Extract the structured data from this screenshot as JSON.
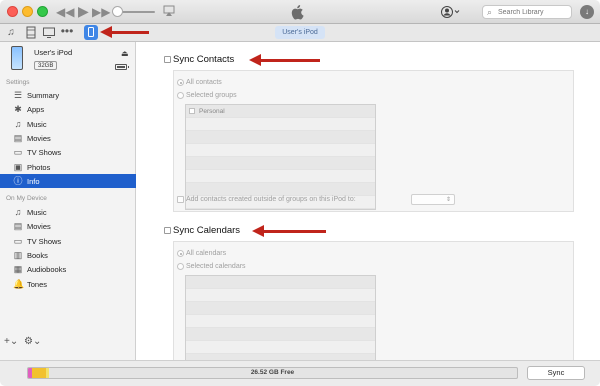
{
  "window": {
    "device_tab": "User's iPod",
    "search": {
      "placeholder": "Search Library"
    }
  },
  "toolbar": {
    "media_icons": [
      "music-note-icon",
      "film-icon",
      "tv-icon",
      "more-icon",
      "iphone-icon"
    ]
  },
  "device": {
    "name": "User's iPod",
    "capacity": "32GB",
    "battery_level": 0.8
  },
  "sidebar": {
    "settings_header": "Settings",
    "settings_items": [
      {
        "label": "Summary",
        "icon": "summary-icon"
      },
      {
        "label": "Apps",
        "icon": "apps-icon"
      },
      {
        "label": "Music",
        "icon": "music-icon"
      },
      {
        "label": "Movies",
        "icon": "movies-icon"
      },
      {
        "label": "TV Shows",
        "icon": "tv-shows-icon"
      },
      {
        "label": "Photos",
        "icon": "photos-icon"
      },
      {
        "label": "Info",
        "icon": "info-icon",
        "active": true
      }
    ],
    "on_device_header": "On My Device",
    "device_items": [
      {
        "label": "Music",
        "icon": "music-icon"
      },
      {
        "label": "Movies",
        "icon": "movies-icon"
      },
      {
        "label": "TV Shows",
        "icon": "tv-shows-icon"
      },
      {
        "label": "Books",
        "icon": "books-icon"
      },
      {
        "label": "Audiobooks",
        "icon": "audiobooks-icon"
      },
      {
        "label": "Tones",
        "icon": "tones-icon"
      }
    ]
  },
  "contacts": {
    "title": "Sync Contacts",
    "all_label": "All contacts",
    "selected_label": "Selected groups",
    "groups": [
      "Personal",
      "",
      "",
      "",
      "",
      "",
      "",
      ""
    ],
    "add_label": "Add contacts created outside of groups on this iPod to:"
  },
  "calendars": {
    "title": "Sync Calendars",
    "all_label": "All calendars",
    "selected_label": "Selected calendars",
    "items": [
      "",
      "",
      "",
      "",
      "",
      "",
      "",
      ""
    ]
  },
  "storage": {
    "free_label": "26.52 GB Free",
    "segments": [
      {
        "name": "audio",
        "color": "#e05fbf",
        "fraction": 0.008
      },
      {
        "name": "photos",
        "color": "#f2c12e",
        "fraction": 0.028
      },
      {
        "name": "other",
        "color": "#f2e26b",
        "fraction": 0.006
      }
    ]
  },
  "actions": {
    "sync_label": "Sync"
  },
  "colors": {
    "accent": "#1f5fcc",
    "annotation_arrow": "#c0241b"
  }
}
